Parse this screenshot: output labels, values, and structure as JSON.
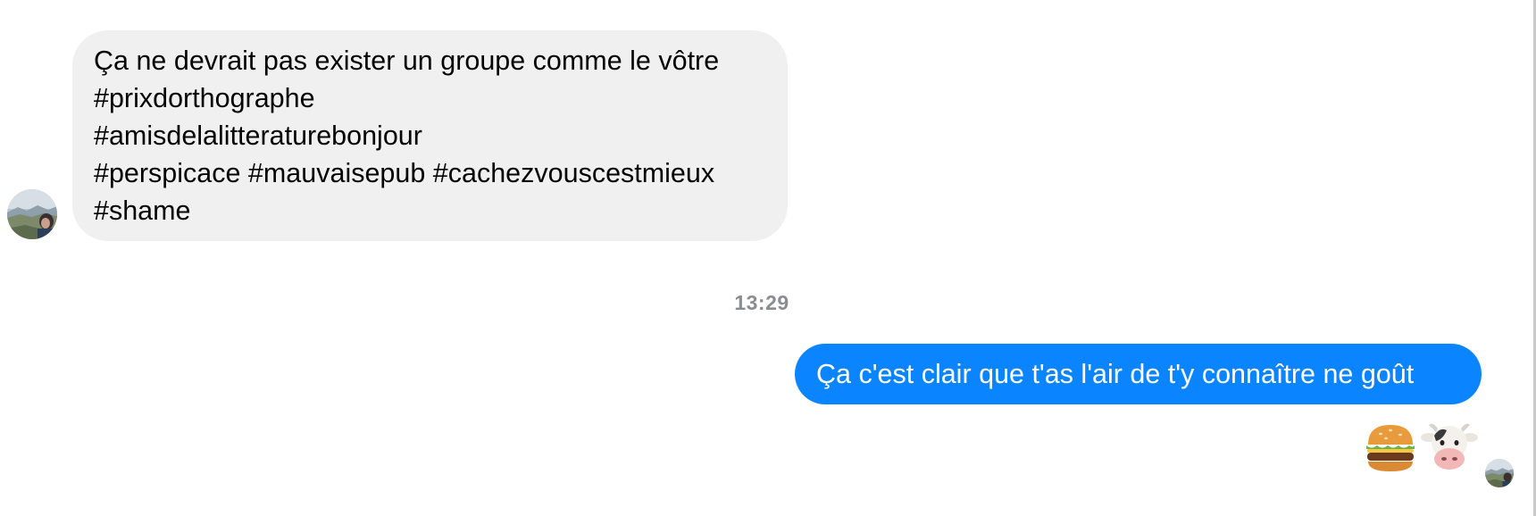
{
  "conversation": {
    "incoming_message": {
      "lines": [
        "Ça ne devrait pas exister un groupe comme le vôtre",
        "#prixdorthographe",
        "#amisdelalitteraturebonjour",
        "#perspicace #mauvaisepub #cachezvouscestmieux",
        "#shame"
      ]
    },
    "timestamp": "13:29",
    "outgoing_message": {
      "text": "Ça c'est clair que t'as l'air de t'y connaître ne goût"
    },
    "outgoing_emojis": [
      "hamburger",
      "cow-face"
    ]
  },
  "colors": {
    "incoming_bubble": "#f0f0f0",
    "outgoing_bubble": "#0b84ff",
    "timestamp_text": "#8a8d91",
    "incoming_text": "#050505",
    "outgoing_text": "#ffffff"
  },
  "icons": {
    "sender_avatar": "sender-avatar",
    "seen_avatar": "seen-receipt-avatar"
  }
}
